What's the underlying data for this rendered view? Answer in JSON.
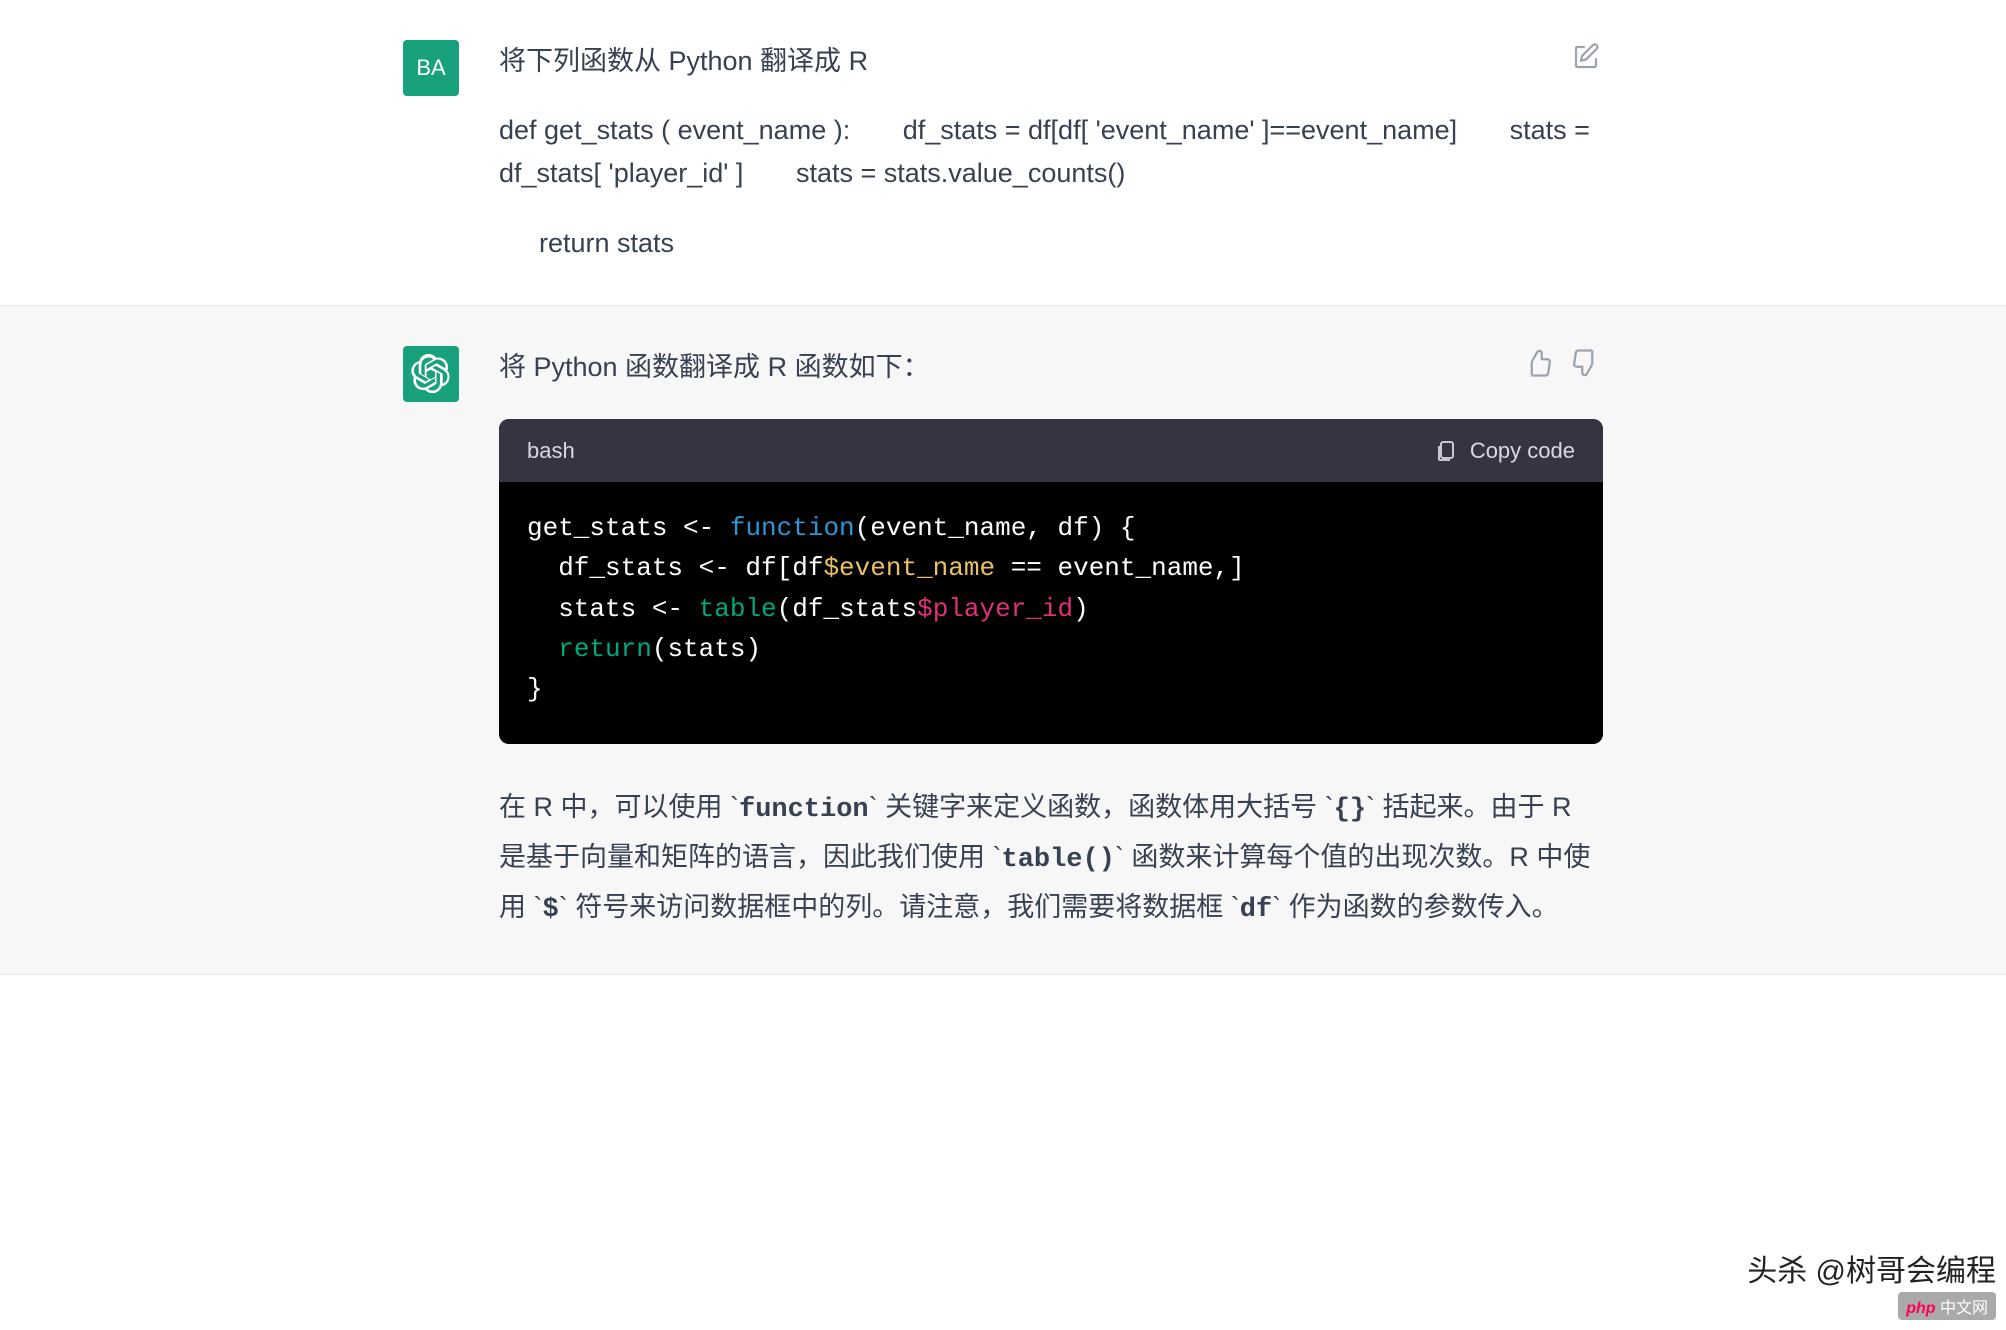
{
  "user": {
    "avatar_initials": "BA",
    "prompt_line1": "将下列函数从 Python 翻译成 R",
    "prompt_line2": "def get_stats ( event_name ):       df_stats = df[df[ 'event_name' ]==event_name]       stats = df_stats[ 'player_id' ]       stats = stats.value_counts()",
    "prompt_line3": "return stats"
  },
  "assistant": {
    "intro": "将 Python 函数翻译成 R 函数如下：",
    "code_lang": "bash",
    "copy_label": "Copy code",
    "code_tokens": [
      [
        [
          "c-w",
          "get_stats <- "
        ],
        [
          "c-b",
          "function"
        ],
        [
          "c-w",
          "(event_name, df) {"
        ]
      ],
      [
        [
          "c-w",
          "  df_stats <- df[df"
        ],
        [
          "c-y",
          "$event_name"
        ],
        [
          "c-w",
          " == event_name,]"
        ]
      ],
      [
        [
          "c-w",
          "  stats <- "
        ],
        [
          "c-t",
          "table"
        ],
        [
          "c-w",
          "(df_stats"
        ],
        [
          "c-p",
          "$player_id"
        ],
        [
          "c-w",
          ")"
        ]
      ],
      [
        [
          "c-w",
          "  "
        ],
        [
          "c-t",
          "return"
        ],
        [
          "c-w",
          "(stats)"
        ]
      ],
      [
        [
          "c-w",
          "}"
        ]
      ]
    ],
    "explanation_parts": [
      {
        "t": "text",
        "v": "在 R 中，可以使用 `"
      },
      {
        "t": "code",
        "v": "function"
      },
      {
        "t": "text",
        "v": "` 关键字来定义函数，函数体用大括号 `"
      },
      {
        "t": "code",
        "v": "{}"
      },
      {
        "t": "text",
        "v": "` 括起来。由于 R 是基于向量和矩阵的语言，因此我们使用 `"
      },
      {
        "t": "code",
        "v": "table()"
      },
      {
        "t": "text",
        "v": "` 函数来计算每个值的出现次数。R 中使用 `"
      },
      {
        "t": "code",
        "v": "$"
      },
      {
        "t": "text",
        "v": "` 符号来访问数据框中的列。请注意，我们需要将数据框 `"
      },
      {
        "t": "code",
        "v": "df"
      },
      {
        "t": "text",
        "v": "` 作为函数的参数传入。"
      }
    ]
  },
  "watermark": {
    "top": "头杀 @树哥会编程",
    "php": "php",
    "cn": "中文网"
  }
}
